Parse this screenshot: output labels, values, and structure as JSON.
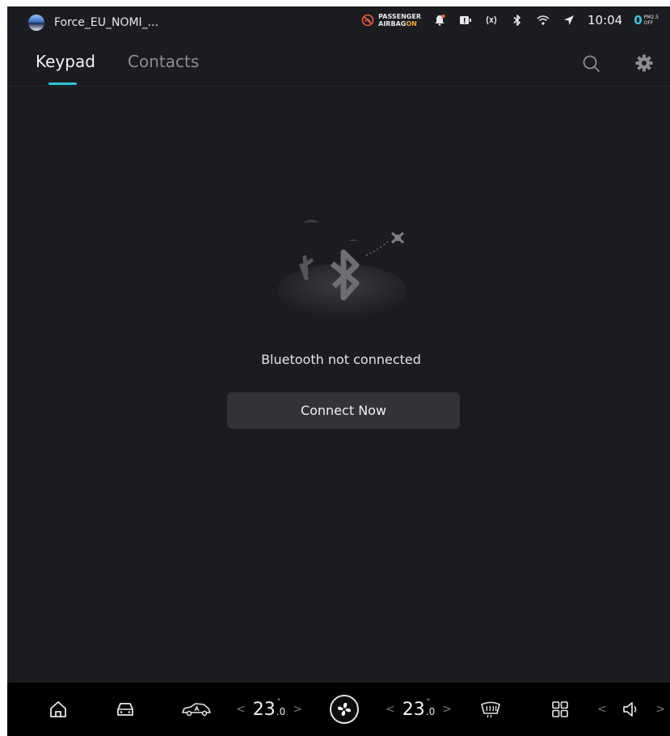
{
  "status_bar": {
    "profile_name": "Force_EU_NOMI_...",
    "airbag_line1": "PASSENGER",
    "airbag_line2": "AIRBAG",
    "airbag_state": "ON",
    "time": "10:04",
    "pm_value": "0",
    "pm_label": "PM2.5",
    "pm_state": "OFF",
    "icons": [
      "airbag-off-icon",
      "notification-bell-icon",
      "battery-warning-icon",
      "nfc-signal-icon",
      "bluetooth-icon",
      "wifi-icon",
      "location-arrow-icon"
    ]
  },
  "tabs": [
    {
      "label": "Keypad",
      "active": true
    },
    {
      "label": "Contacts",
      "active": false
    }
  ],
  "header_icons": [
    "search-icon",
    "settings-gear-icon"
  ],
  "empty_state": {
    "illustration": "bluetooth-disconnected-illustration",
    "message": "Bluetooth not connected",
    "action_label": "Connect Now"
  },
  "dock": {
    "left_temp_main": "23",
    "left_temp_decimal": ".0",
    "right_temp_main": "23",
    "right_temp_decimal": ".0",
    "prev_symbol": "<",
    "next_symbol": ">",
    "icons": [
      "home-icon",
      "car-icon",
      "car-side-icon",
      "fan-icon",
      "rear-defrost-icon",
      "apps-grid-icon",
      "volume-icon"
    ]
  },
  "colors": {
    "background": "#1b1c20",
    "accent": "#2fc6d8",
    "button": "#323337",
    "dock": "#000000",
    "airbag_on": "#f5a623"
  }
}
